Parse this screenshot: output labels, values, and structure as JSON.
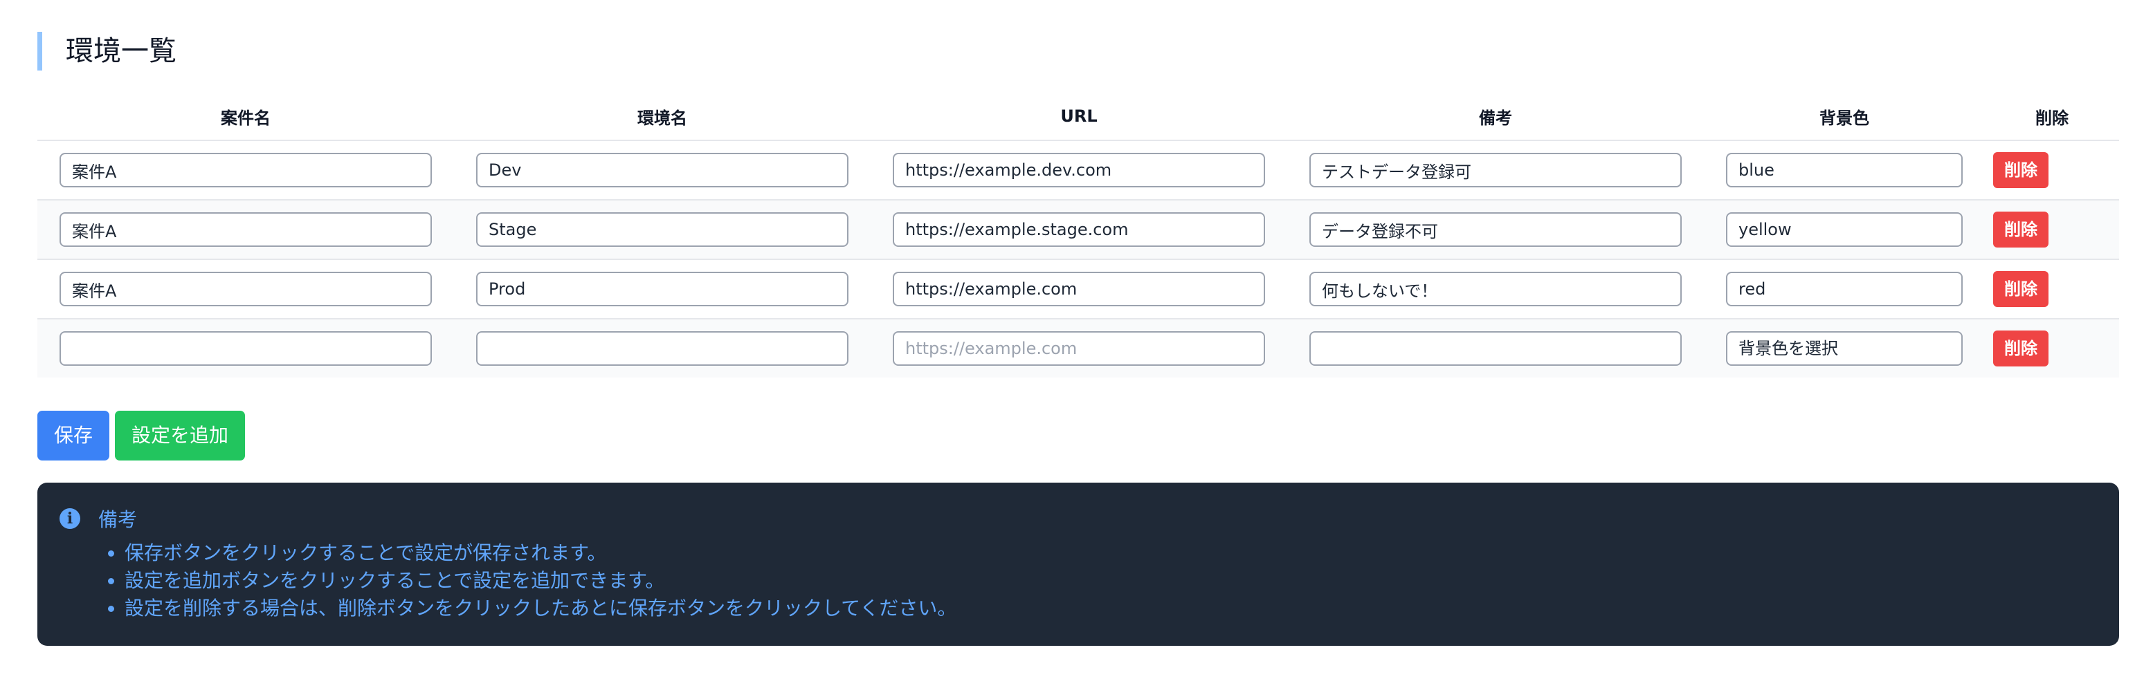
{
  "page": {
    "title": "環境一覧"
  },
  "table": {
    "headers": {
      "project": "案件名",
      "environment": "環境名",
      "url": "URL",
      "notes": "備考",
      "background_color": "背景色",
      "delete": "削除"
    },
    "rows": [
      {
        "project": "案件A",
        "environment": "Dev",
        "url": "https://example.dev.com",
        "notes": "テストデータ登録可",
        "background_color": "blue",
        "delete_label": "削除"
      },
      {
        "project": "案件A",
        "environment": "Stage",
        "url": "https://example.stage.com",
        "notes": "データ登録不可",
        "background_color": "yellow",
        "delete_label": "削除"
      },
      {
        "project": "案件A",
        "environment": "Prod",
        "url": "https://example.com",
        "notes": "何もしないで！",
        "background_color": "red",
        "delete_label": "削除"
      },
      {
        "project": "",
        "environment": "",
        "url": "",
        "url_placeholder": "https://example.com",
        "notes": "",
        "background_color": "背景色を選択",
        "delete_label": "削除"
      }
    ]
  },
  "actions": {
    "save_label": "保存",
    "add_label": "設定を追加"
  },
  "notes_panel": {
    "icon": "info-icon",
    "title": "備考",
    "items": [
      "保存ボタンをクリックすることで設定が保存されます。",
      "設定を追加ボタンをクリックすることで設定を追加できます。",
      "設定を削除する場合は、削除ボタンをクリックしたあとに保存ボタンをクリックしてください。"
    ]
  },
  "colors": {
    "title_accent": "#93c5fd",
    "save_button": "#3b82f6",
    "add_button": "#22c55e",
    "delete_button": "#ef4444",
    "notes_background": "#1f2937",
    "notes_text": "#60a5fa"
  }
}
